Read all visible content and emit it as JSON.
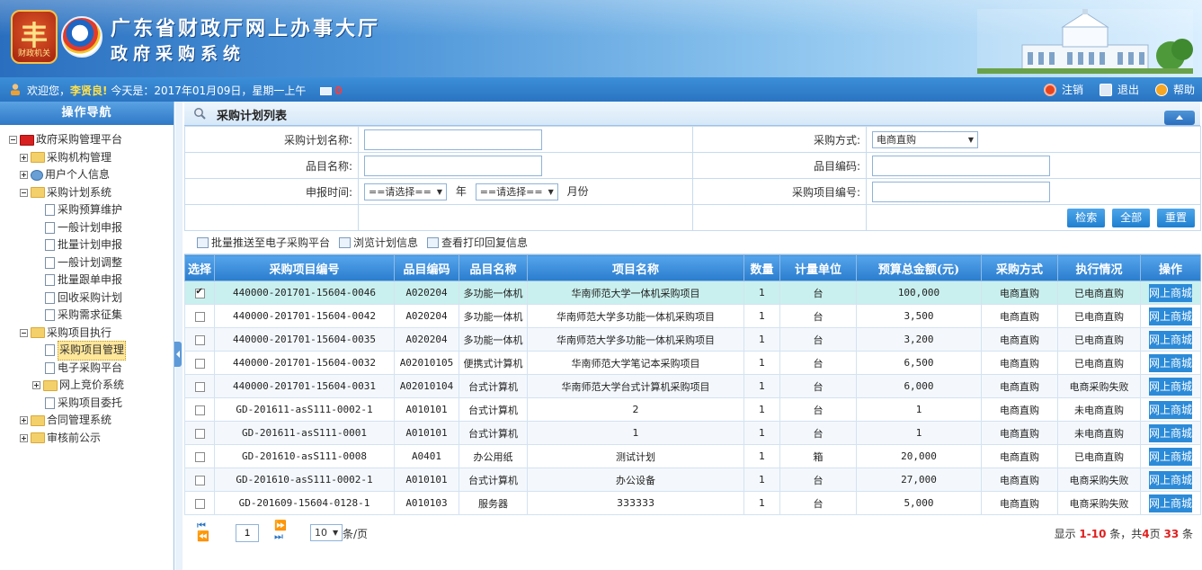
{
  "banner": {
    "logo_text": "财政机关",
    "title": "广东省财政厅网上办事大厅",
    "subtitle": "政府采购系统"
  },
  "welcome": {
    "prefix": "欢迎您，",
    "user": "李贤良!",
    "date_text": " 今天是：2017年01月09日，星期一上午",
    "mail_count": "0",
    "links": {
      "logout": "注销",
      "exit": "退出",
      "help": "帮助"
    }
  },
  "sidebar": {
    "header": "操作导航",
    "tree": [
      {
        "label": "政府采购管理平台"
      },
      {
        "label": "采购机构管理"
      },
      {
        "label": "用户个人信息"
      },
      {
        "label": "采购计划系统"
      },
      {
        "label": "采购预算维护"
      },
      {
        "label": "一般计划申报"
      },
      {
        "label": "批量计划申报"
      },
      {
        "label": "一般计划调整"
      },
      {
        "label": "批量跟单申报"
      },
      {
        "label": "回收采购计划"
      },
      {
        "label": "采购需求征集"
      },
      {
        "label": "采购项目执行"
      },
      {
        "label": "采购项目管理"
      },
      {
        "label": "电子采购平台"
      },
      {
        "label": "网上竞价系统"
      },
      {
        "label": "采购项目委托"
      },
      {
        "label": "合同管理系统"
      },
      {
        "label": "审核前公示"
      }
    ]
  },
  "panel": {
    "title": "采购计划列表"
  },
  "filters": {
    "plan_name_label": "采购计划名称:",
    "method_label": "采购方式:",
    "method_value": "电商直购",
    "item_name_label": "品目名称:",
    "item_code_label": "品目编码:",
    "date_label": "申报时间:",
    "year_select": "==请选择==",
    "year_unit": "年",
    "month_select": "==请选择==",
    "month_unit": "月份",
    "project_code_label": "采购项目编号:",
    "buttons": {
      "search": "检索",
      "all": "全部",
      "reset": "重置"
    }
  },
  "toolbar": {
    "push": "批量推送至电子采购平台",
    "browse": "浏览计划信息",
    "print": "查看打印回复信息"
  },
  "table": {
    "headers": [
      "选择",
      "采购项目编号",
      "品目编码",
      "品目名称",
      "项目名称",
      "数量",
      "计量单位",
      "预算总金额(元)",
      "采购方式",
      "执行情况",
      "操作"
    ],
    "rows": [
      {
        "checked": true,
        "code": "440000-201701-15604-0046",
        "item_code": "A020204",
        "item_name": "多功能一体机",
        "project": "华南师范大学一体机采购项目",
        "qty": "1",
        "unit": "台",
        "amount": "100,000",
        "method": "电商直购",
        "status": "已电商直购",
        "status_type": "ok",
        "op": "网上商城"
      },
      {
        "checked": false,
        "code": "440000-201701-15604-0042",
        "item_code": "A020204",
        "item_name": "多功能一体机",
        "project": "华南师范大学多功能一体机采购项目",
        "qty": "1",
        "unit": "台",
        "amount": "3,500",
        "method": "电商直购",
        "status": "已电商直购",
        "status_type": "ok",
        "op": "网上商城"
      },
      {
        "checked": false,
        "code": "440000-201701-15604-0035",
        "item_code": "A020204",
        "item_name": "多功能一体机",
        "project": "华南师范大学多功能一体机采购项目",
        "qty": "1",
        "unit": "台",
        "amount": "3,200",
        "method": "电商直购",
        "status": "已电商直购",
        "status_type": "ok",
        "op": "网上商城"
      },
      {
        "checked": false,
        "code": "440000-201701-15604-0032",
        "item_code": "A02010105",
        "item_name": "便携式计算机",
        "project": "华南师范大学笔记本采购项目",
        "qty": "1",
        "unit": "台",
        "amount": "6,500",
        "method": "电商直购",
        "status": "已电商直购",
        "status_type": "ok",
        "op": "网上商城"
      },
      {
        "checked": false,
        "code": "440000-201701-15604-0031",
        "item_code": "A02010104",
        "item_name": "台式计算机",
        "project": "华南师范大学台式计算机采购项目",
        "qty": "1",
        "unit": "台",
        "amount": "6,000",
        "method": "电商直购",
        "status": "电商采购失败",
        "status_type": "fail",
        "op": "网上商城"
      },
      {
        "checked": false,
        "code": "GD-201611-asS111-0002-1",
        "item_code": "A010101",
        "item_name": "台式计算机",
        "project": "2",
        "qty": "1",
        "unit": "台",
        "amount": "1",
        "method": "电商直购",
        "status": "未电商直购",
        "status_type": "no",
        "op": "网上商城"
      },
      {
        "checked": false,
        "code": "GD-201611-asS111-0001",
        "item_code": "A010101",
        "item_name": "台式计算机",
        "project": "1",
        "qty": "1",
        "unit": "台",
        "amount": "1",
        "method": "电商直购",
        "status": "未电商直购",
        "status_type": "no",
        "op": "网上商城"
      },
      {
        "checked": false,
        "code": "GD-201610-asS111-0008",
        "item_code": "A0401",
        "item_name": "办公用纸",
        "project": "测试计划",
        "qty": "1",
        "unit": "箱",
        "amount": "20,000",
        "method": "电商直购",
        "status": "已电商直购",
        "status_type": "ok",
        "op": "网上商城"
      },
      {
        "checked": false,
        "code": "GD-201610-asS111-0002-1",
        "item_code": "A010101",
        "item_name": "台式计算机",
        "project": "办公设备",
        "qty": "1",
        "unit": "台",
        "amount": "27,000",
        "method": "电商直购",
        "status": "电商采购失败",
        "status_type": "fail",
        "op": "网上商城"
      },
      {
        "checked": false,
        "code": "GD-201609-15604-0128-1",
        "item_code": "A010103",
        "item_name": "服务器",
        "project": "333333",
        "qty": "1",
        "unit": "台",
        "amount": "5,000",
        "method": "电商直购",
        "status": "电商采购失败",
        "status_type": "fail",
        "op": "网上商城"
      }
    ]
  },
  "pager": {
    "page": "1",
    "page_size": "10",
    "unit": "条/页",
    "info_prefix": "显示 ",
    "range": "1-10",
    "info_mid": " 条，共",
    "pages": "4",
    "info_mid2": "页 ",
    "total": "33",
    "info_suffix": " 条"
  }
}
